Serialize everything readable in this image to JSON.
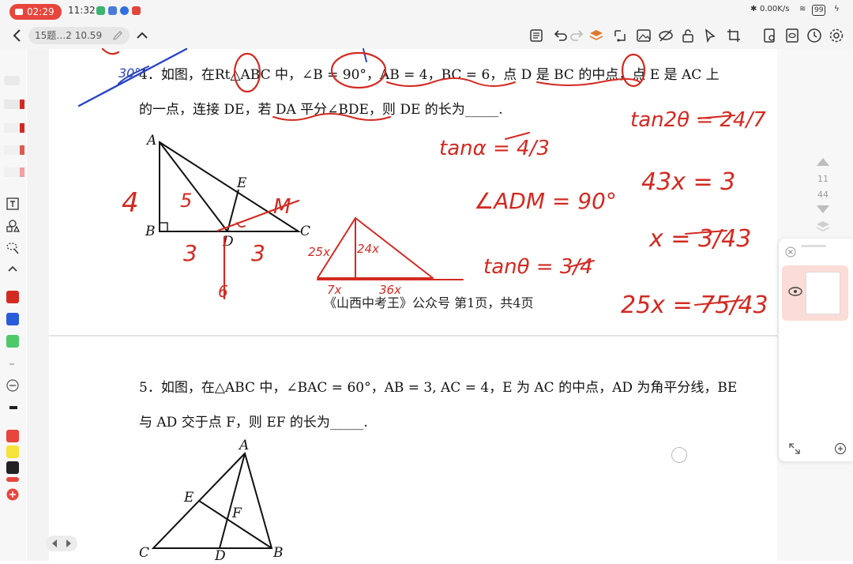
{
  "status": {
    "record_time": "02:29",
    "clock": "11:32",
    "net_speed": "0.00K/s",
    "battery": "99"
  },
  "toolbar": {
    "doc_title": "15题…2 10.59"
  },
  "colors": {
    "ink_red": "#d32a22",
    "ink_blue": "#2a43c4",
    "rec_red": "#e8453c",
    "panel_pink": "#fbdcd6"
  },
  "q4": {
    "line1": "4．如图，在Rt△ABC 中，∠B = 90°，AB = 4，BC = 6，点 D 是 BC 的中点，点 E 是 AC 上",
    "line2": "的一点，连接 DE，若 DA 平分∠BDE，则 DE 的长为_____."
  },
  "q5": {
    "line1": "5．如图，在△ABC 中，∠BAC = 60°，AB = 3, AC = 4，E 为 AC 的中点，AD 为角平分线，BE",
    "line2": "与 AD 交于点 F，则 EF 的长为_____."
  },
  "page_footer": "《山西中考王》公众号  第1页，共4页",
  "fig4_labels": {
    "A": "A",
    "B": "B",
    "C": "C",
    "D": "D",
    "E": "E"
  },
  "fig5_labels": {
    "A": "A",
    "B": "B",
    "C": "C",
    "D": "D",
    "E": "E",
    "F": "F"
  },
  "ink": {
    "tan_a": "tanα = 4/3",
    "tan2t": "tan2θ = 24/7",
    "angle_adm": "∠ADM = 90°",
    "tan_t": "tanθ = 3/4",
    "eq1": "43x = 3",
    "eq2": "x = 3/43",
    "eq3": "25x = 75/43",
    "side_4": "4",
    "side_5": "5",
    "side_3a": "3",
    "side_3b": "3",
    "label_M": "M",
    "label_25x": "25x",
    "label_24x": "24x",
    "label_7x": "7x",
    "label_36x": "36x",
    "label_30": "30°",
    "label_6": "6"
  },
  "nav": {
    "current_page": "11",
    "total_pages": "44"
  }
}
